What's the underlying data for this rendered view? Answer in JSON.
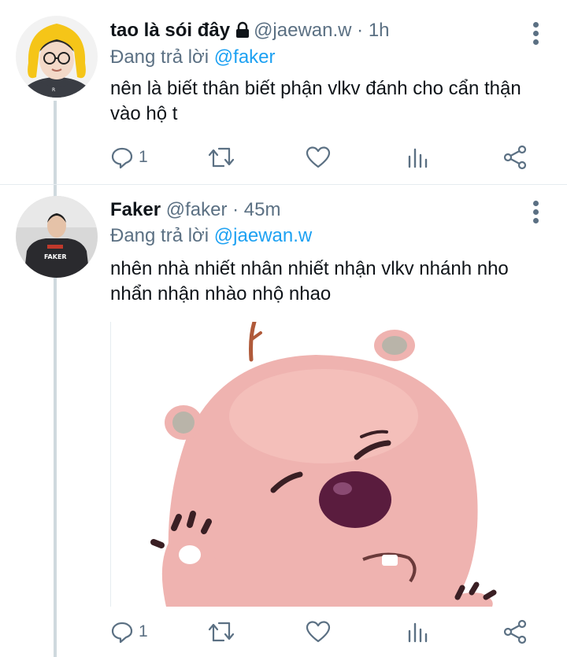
{
  "tweets": [
    {
      "display_name": "tao là sói đây",
      "protected_icon": "lock-icon",
      "handle": "@jaewan.w",
      "separator": "·",
      "time": "1h",
      "reply_prefix": "Đang trả lời",
      "reply_to": "@faker",
      "text": "nên là biết thân biết phận vlkv đánh cho cẩn thận vào hộ t",
      "reply_count": "1",
      "retweet_count": "",
      "like_count": ""
    },
    {
      "display_name": "Faker",
      "handle": "@faker",
      "separator": "·",
      "time": "45m",
      "reply_prefix": "Đang trả lời",
      "reply_to": "@jaewan.w",
      "text": "nhên nhà nhiết nhân nhiết nhận vlkv nhánh nho nhẩn nhận nhào nhộ nhao",
      "reply_count": "1",
      "retweet_count": "",
      "like_count": ""
    }
  ],
  "icons": {
    "reply": "reply-icon",
    "retweet": "retweet-icon",
    "like": "heart-icon",
    "analytics": "analytics-icon",
    "share": "share-icon",
    "more": "more-vertical-icon"
  },
  "colors": {
    "text": "#0f1419",
    "secondary": "#5b7083",
    "link": "#1da1f2",
    "thread_line": "#cfd9de",
    "divider": "#e6ecf0"
  }
}
